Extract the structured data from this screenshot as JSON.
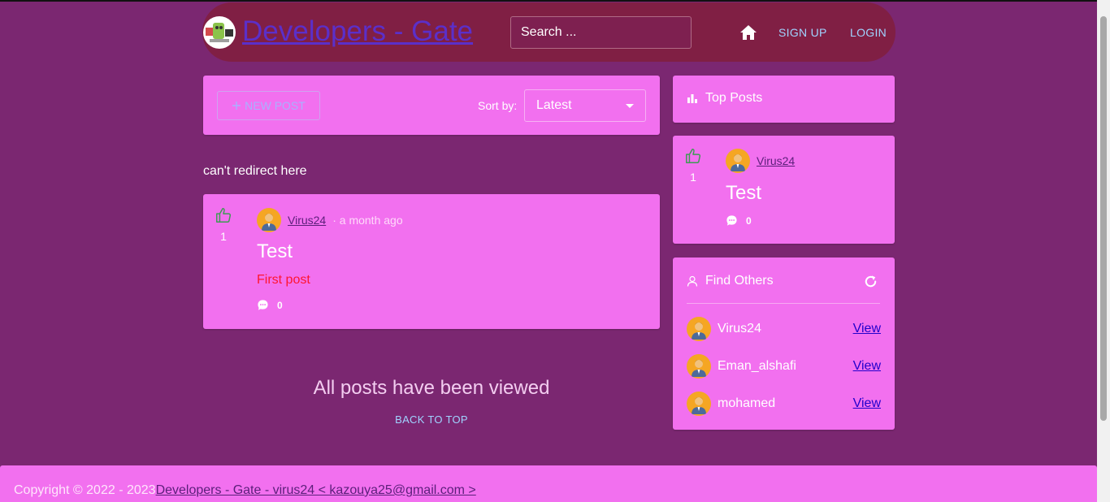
{
  "header": {
    "brand": "Developers - Gate",
    "search_placeholder": "Search ...",
    "nav": {
      "signup": "SIGN UP",
      "login": "LOGIN"
    }
  },
  "toolbar": {
    "new_post_label": "NEW POST",
    "sort_label": "Sort by:",
    "sort_value": "Latest"
  },
  "notice": "can't redirect here",
  "posts": [
    {
      "likes": "1",
      "author": "Virus24",
      "time": "· a month ago",
      "title": "Test",
      "body": "First post",
      "comments": "0"
    }
  ],
  "feed_end": {
    "message": "All posts have been viewed",
    "back_to_top": "BACK TO TOP"
  },
  "top_posts": {
    "title": "Top Posts",
    "items": [
      {
        "likes": "1",
        "author": "Virus24",
        "title": "Test",
        "comments": "0"
      }
    ]
  },
  "find_others": {
    "title": "Find Others",
    "users": [
      {
        "name": "Virus24",
        "action": "View"
      },
      {
        "name": "Eman_alshafi",
        "action": "View"
      },
      {
        "name": "mohamed",
        "action": "View"
      }
    ]
  },
  "footer": {
    "copyright": "Copyright © 2022 - 2023",
    "link": "Developers - Gate - virus24 < kazouya25@gmail.com >"
  },
  "colors": {
    "background": "#7b2771",
    "navbar": "#801f44",
    "card": "#f270ef",
    "avatar": "#f5a623",
    "like_icon": "#3f9a55",
    "nav_link": "#9fd3ff"
  }
}
